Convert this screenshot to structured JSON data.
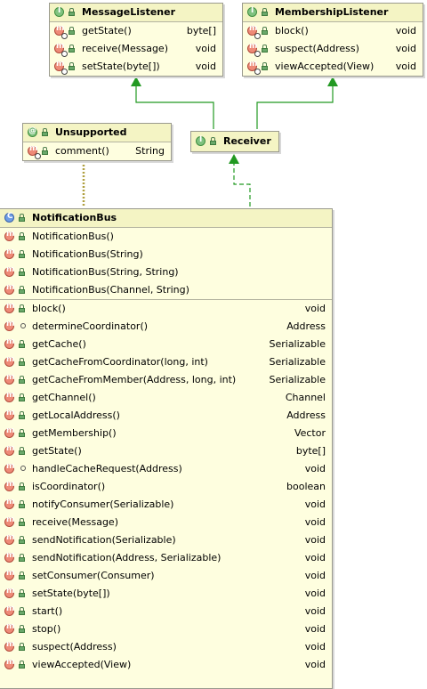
{
  "message_listener": {
    "name": "MessageListener",
    "methods": [
      {
        "name": "getState()",
        "type": "byte[]"
      },
      {
        "name": "receive(Message)",
        "type": "void"
      },
      {
        "name": "setState(byte[])",
        "type": "void"
      }
    ]
  },
  "membership_listener": {
    "name": "MembershipListener",
    "methods": [
      {
        "name": "block()",
        "type": "void"
      },
      {
        "name": "suspect(Address)",
        "type": "void"
      },
      {
        "name": "viewAccepted(View)",
        "type": "void"
      }
    ]
  },
  "unsupported": {
    "name": "Unsupported",
    "methods": [
      {
        "name": "comment()",
        "type": "String"
      }
    ]
  },
  "receiver": {
    "name": "Receiver"
  },
  "notification_bus": {
    "name": "NotificationBus",
    "constructors": [
      {
        "name": "NotificationBus()"
      },
      {
        "name": "NotificationBus(String)"
      },
      {
        "name": "NotificationBus(String, String)"
      },
      {
        "name": "NotificationBus(Channel, String)"
      }
    ],
    "methods": [
      {
        "name": "block()",
        "type": "void",
        "access": "public"
      },
      {
        "name": "determineCoordinator()",
        "type": "Address",
        "access": "package"
      },
      {
        "name": "getCache()",
        "type": "Serializable",
        "access": "public"
      },
      {
        "name": "getCacheFromCoordinator(long, int)",
        "type": "Serializable",
        "access": "public"
      },
      {
        "name": "getCacheFromMember(Address, long, int)",
        "type": "Serializable",
        "access": "public"
      },
      {
        "name": "getChannel()",
        "type": "Channel",
        "access": "public"
      },
      {
        "name": "getLocalAddress()",
        "type": "Address",
        "access": "public"
      },
      {
        "name": "getMembership()",
        "type": "Vector",
        "access": "public"
      },
      {
        "name": "getState()",
        "type": "byte[]",
        "access": "public"
      },
      {
        "name": "handleCacheRequest(Address)",
        "type": "void",
        "access": "package"
      },
      {
        "name": "isCoordinator()",
        "type": "boolean",
        "access": "public"
      },
      {
        "name": "notifyConsumer(Serializable)",
        "type": "void",
        "access": "public"
      },
      {
        "name": "receive(Message)",
        "type": "void",
        "access": "public"
      },
      {
        "name": "sendNotification(Serializable)",
        "type": "void",
        "access": "public"
      },
      {
        "name": "sendNotification(Address, Serializable)",
        "type": "void",
        "access": "public"
      },
      {
        "name": "setConsumer(Consumer)",
        "type": "void",
        "access": "public"
      },
      {
        "name": "setState(byte[])",
        "type": "void",
        "access": "public"
      },
      {
        "name": "start()",
        "type": "void",
        "access": "public"
      },
      {
        "name": "stop()",
        "type": "void",
        "access": "public"
      },
      {
        "name": "suspect(Address)",
        "type": "void",
        "access": "public"
      },
      {
        "name": "viewAccepted(View)",
        "type": "void",
        "access": "public"
      }
    ]
  },
  "colors": {
    "box_fill": "#fefedf",
    "header_fill": "#f4f4c4",
    "realization_arrow": "#229922",
    "annotation_link": "#b0a040"
  }
}
